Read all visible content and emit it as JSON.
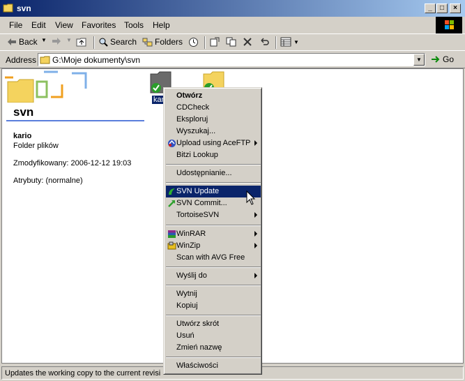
{
  "window": {
    "title": "svn"
  },
  "menu": {
    "items": [
      "File",
      "Edit",
      "View",
      "Favorites",
      "Tools",
      "Help"
    ]
  },
  "toolbar": {
    "back": "Back",
    "search": "Search",
    "folders": "Folders"
  },
  "address": {
    "label": "Address",
    "value": "G:\\Moje dokumenty\\svn",
    "go": "Go"
  },
  "details": {
    "folder_title": "svn",
    "name": "kario",
    "type": "Folder plików",
    "modified": "Zmodyfikowany: 2006-12-12 19:03",
    "attributes": "Atrybuty: (normalne)"
  },
  "files": [
    {
      "label": "kar"
    }
  ],
  "context_menu": {
    "items": [
      {
        "label": "Otwórz",
        "bold": true
      },
      {
        "label": "CDCheck"
      },
      {
        "label": "Eksploruj"
      },
      {
        "label": "Wyszukaj..."
      },
      {
        "label": "Upload using AceFTP",
        "submenu": true,
        "icon": "aceftp-icon"
      },
      {
        "label": "Bitzi Lookup"
      },
      {
        "label": "Udostępnianie..."
      },
      {
        "label": "SVN Update",
        "icon": "svn-update-icon",
        "highlighted": true
      },
      {
        "label": "SVN Commit...",
        "icon": "svn-commit-icon"
      },
      {
        "label": "TortoiseSVN",
        "submenu": true
      },
      {
        "label": "WinRAR",
        "submenu": true,
        "icon": "winrar-icon"
      },
      {
        "label": "WinZip",
        "submenu": true,
        "icon": "winzip-icon"
      },
      {
        "label": "Scan with AVG Free"
      },
      {
        "label": "Wyślij do",
        "submenu": true
      },
      {
        "label": "Wytnij"
      },
      {
        "label": "Kopiuj"
      },
      {
        "label": "Utwórz skrót"
      },
      {
        "label": "Usuń"
      },
      {
        "label": "Zmień nazwę"
      },
      {
        "label": "Właściwości"
      }
    ]
  },
  "status": {
    "text": "Updates the working copy to the current revisi"
  },
  "colors": {
    "titlebar_start": "#0a246a",
    "titlebar_end": "#a6caf0",
    "highlight": "#0a246a",
    "face": "#d4d0c8"
  }
}
